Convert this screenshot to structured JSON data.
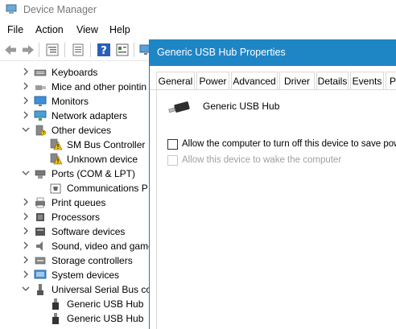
{
  "window": {
    "title": "Device Manager"
  },
  "menu": [
    "File",
    "Action",
    "View",
    "Help"
  ],
  "toolbar": {
    "buttons": [
      "back-icon",
      "forward-icon",
      "tree-view-icon",
      "properties-icon",
      "help-icon",
      "view-icon",
      "monitor-icon"
    ]
  },
  "tree": {
    "rows": [
      {
        "label": "Keyboards",
        "expanded": false,
        "level": 1,
        "icon": "keyboard-icon"
      },
      {
        "label": "Mice and other pointin",
        "expanded": false,
        "level": 1,
        "icon": "mouse-icon"
      },
      {
        "label": "Monitors",
        "expanded": false,
        "level": 1,
        "icon": "monitor-icon"
      },
      {
        "label": "Network adapters",
        "expanded": false,
        "level": 1,
        "icon": "network-icon"
      },
      {
        "label": "Other devices",
        "expanded": true,
        "level": 1,
        "icon": "other-devices-icon"
      },
      {
        "label": "SM Bus Controller",
        "level": 2,
        "icon": "warning-device-icon"
      },
      {
        "label": "Unknown device",
        "level": 2,
        "icon": "warning-device-icon"
      },
      {
        "label": "Ports (COM & LPT)",
        "expanded": true,
        "level": 1,
        "icon": "port-icon"
      },
      {
        "label": "Communications P",
        "level": 2,
        "icon": "communications-port-icon"
      },
      {
        "label": "Print queues",
        "expanded": false,
        "level": 1,
        "icon": "printer-icon"
      },
      {
        "label": "Processors",
        "expanded": false,
        "level": 1,
        "icon": "processor-icon"
      },
      {
        "label": "Software devices",
        "expanded": false,
        "level": 1,
        "icon": "software-device-icon"
      },
      {
        "label": "Sound, video and game",
        "expanded": false,
        "level": 1,
        "icon": "speaker-icon"
      },
      {
        "label": "Storage controllers",
        "expanded": false,
        "level": 1,
        "icon": "storage-icon"
      },
      {
        "label": "System devices",
        "expanded": false,
        "level": 1,
        "icon": "system-device-icon"
      },
      {
        "label": "Universal Serial Bus cor",
        "expanded": true,
        "level": 1,
        "icon": "usb-icon"
      },
      {
        "label": "Generic USB Hub",
        "level": 2,
        "icon": "usb-plug-icon"
      },
      {
        "label": "Generic USB Hub",
        "level": 2,
        "icon": "usb-plug-icon"
      }
    ]
  },
  "properties": {
    "title": "Generic USB Hub Properties",
    "tabs": [
      "General",
      "Power",
      "Advanced",
      "Driver",
      "Details",
      "Events",
      "Po"
    ],
    "device_name": "Generic USB Hub",
    "options": [
      {
        "label": "Allow the computer to turn off this device to save power",
        "checked": false,
        "enabled": true
      },
      {
        "label": "Allow this device to wake the computer",
        "checked": false,
        "enabled": false
      }
    ]
  },
  "colors": {
    "title_bar": "#1f86c6",
    "warning": "#f5c400",
    "chevron": "#555555"
  }
}
